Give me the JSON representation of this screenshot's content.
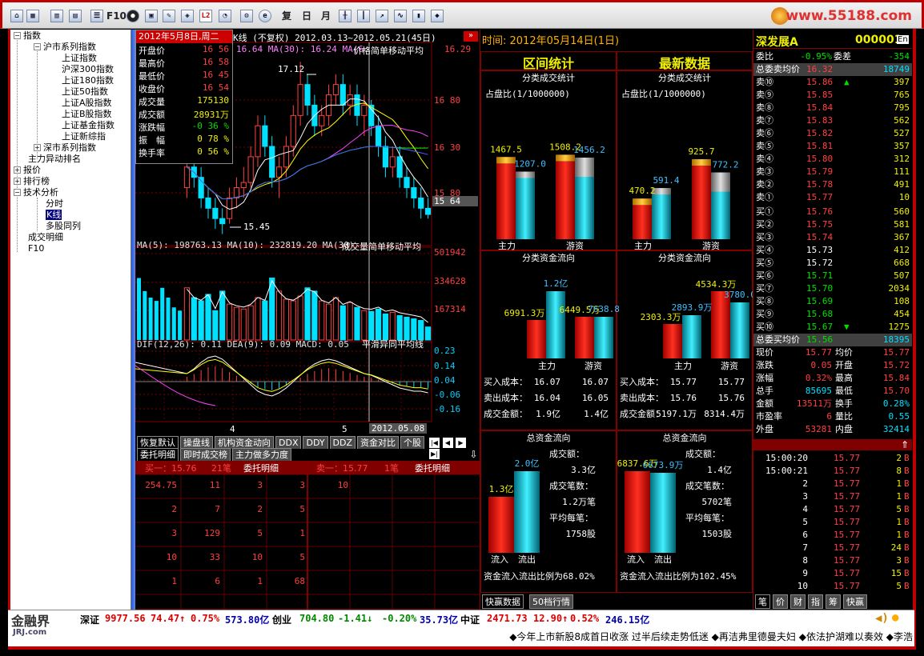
{
  "toolbar": {
    "items": [
      "复",
      "日",
      "月",
      "F10",
      "L2"
    ],
    "brand": "www.55188.com"
  },
  "tree": {
    "items": [
      "指数",
      "沪市系列指数",
      "上证指数",
      "沪深300指数",
      "上证180指数",
      "上证50指数",
      "上证A股指数",
      "上证B股指数",
      "上证基金指数",
      "上证新综指",
      "深市系列指数",
      "主力异动排名",
      "报价",
      "排行榜",
      "技术分析",
      "分时",
      "K线",
      "多股同列",
      "成交明细",
      "F10"
    ]
  },
  "chart": {
    "title_date": "2012年5月8日,周二",
    "title": "K线 (不复权) 2012.03.13~2012.05.21(45日)",
    "ma_line": "16.64  MA(30): 16.24  MA(6",
    "price_avg_label": "价格简单移动平均",
    "price_right": "16.29",
    "ohlc_labels": [
      "开盘价",
      "最高价",
      "最低价",
      "收盘价",
      "成交量",
      "成交额",
      "涨跌幅",
      "振　幅",
      "换手率"
    ],
    "ohlc_values": [
      "16 56",
      "16 58",
      "16 45",
      "16 54",
      "175130",
      "28931万",
      "-0 36 %",
      "0 78 %",
      "0 56 %"
    ],
    "price_axis": [
      "16 80",
      "16 30",
      "15 80"
    ],
    "current_price": "15 64",
    "high_label": "17.12",
    "low_label": "15.45",
    "vol_line": "MA(5): 198763.13 MA(10): 232819.20 MA(30)",
    "vol_label": "成交量简单移动平均",
    "vol_axis": [
      "501942",
      "334628",
      "167314"
    ],
    "macd_line": "DIF(12,26): 0.11 DEA(9): 0.09 MACD: 0.05",
    "macd_label": "平滑异同平均线",
    "macd_axis": [
      "0.23",
      "0.14",
      "0.04",
      "-0.06",
      "-0.16"
    ],
    "xaxis": [
      "4",
      "5",
      "2012.05.08"
    ]
  },
  "chart_data": {
    "type": "candlestick",
    "title": "K线 (不复权) 2012.03.13~2012.05.21(45日)",
    "ylim": [
      15.4,
      17.2
    ],
    "candles": [
      [
        15.9,
        16.2,
        15.8,
        16.1
      ],
      [
        16.1,
        16.3,
        15.9,
        16.0
      ],
      [
        16.0,
        16.1,
        15.7,
        15.8
      ],
      [
        15.8,
        15.9,
        15.6,
        15.7
      ],
      [
        15.7,
        15.8,
        15.5,
        15.6
      ],
      [
        15.6,
        15.7,
        15.45,
        15.55
      ],
      [
        15.6,
        15.9,
        15.55,
        15.8
      ],
      [
        15.8,
        16.0,
        15.7,
        15.9
      ],
      [
        15.9,
        16.1,
        15.8,
        15.95
      ],
      [
        15.95,
        16.3,
        15.9,
        16.2
      ],
      [
        16.2,
        16.6,
        16.1,
        16.5
      ],
      [
        16.5,
        16.6,
        16.2,
        16.3
      ],
      [
        16.3,
        16.4,
        15.9,
        16.0
      ],
      [
        16.0,
        16.2,
        15.8,
        16.1
      ],
      [
        16.1,
        16.4,
        16.0,
        16.3
      ],
      [
        16.3,
        16.7,
        16.2,
        16.6
      ],
      [
        16.6,
        17.12,
        16.5,
        16.9
      ],
      [
        16.9,
        17.0,
        16.6,
        16.7
      ],
      [
        16.7,
        16.8,
        16.4,
        16.5
      ],
      [
        16.5,
        16.7,
        16.4,
        16.6
      ],
      [
        16.6,
        16.9,
        16.5,
        16.8
      ],
      [
        16.8,
        17.0,
        16.7,
        16.9
      ],
      [
        16.9,
        17.0,
        16.6,
        16.7
      ],
      [
        16.7,
        16.9,
        16.6,
        16.8
      ],
      [
        16.8,
        16.9,
        16.5,
        16.6
      ],
      [
        16.6,
        16.8,
        16.4,
        16.7
      ],
      [
        16.7,
        16.75,
        16.4,
        16.5
      ],
      [
        16.5,
        16.6,
        16.2,
        16.3
      ],
      [
        16.3,
        16.4,
        16.0,
        16.1
      ],
      [
        16.1,
        16.3,
        16.0,
        16.2
      ],
      [
        16.2,
        16.3,
        15.9,
        16.0
      ],
      [
        16.0,
        16.1,
        15.8,
        15.9
      ],
      [
        15.9,
        16.0,
        15.7,
        15.8
      ],
      [
        15.8,
        15.9,
        15.6,
        15.7
      ],
      [
        15.7,
        15.8,
        15.6,
        15.64
      ]
    ],
    "volumes": [
      320000,
      260000,
      240000,
      280000,
      180000,
      300000,
      220000,
      200000,
      190000,
      210000,
      260000,
      240000,
      380000,
      300000,
      250000,
      240000,
      270000,
      320000,
      300000,
      240000,
      220000,
      260000,
      210000,
      230000,
      200000,
      180000,
      175130,
      190000,
      160000,
      170000,
      150000,
      140000,
      130000,
      120000,
      80000
    ],
    "macd": [
      0.05,
      0.08,
      0.12,
      0.15,
      0.16,
      0.14,
      0.1,
      0.06,
      0.02,
      -0.02,
      -0.06,
      -0.08,
      -0.09,
      -0.07,
      -0.04,
      0.0,
      0.04,
      0.08,
      0.11,
      0.13,
      0.14,
      0.13,
      0.11,
      0.09,
      0.07,
      0.05,
      0.04,
      0.02,
      0.0,
      -0.02,
      -0.04,
      -0.05,
      -0.06,
      -0.06,
      -0.07
    ]
  },
  "bottom": {
    "tabs": [
      "恢复默认",
      "操盘线",
      "机构资金动向",
      "DDX",
      "DDY",
      "DDZ",
      "资金对比",
      "个股"
    ],
    "subtabs": [
      "委托明细",
      "即时成交榜",
      "主力做多力度"
    ],
    "buy_title": "买一：15.76",
    "buy_count": "21笔",
    "buy_detail": "委托明细",
    "sell_title": "卖一：15.77",
    "sell_count": "1笔",
    "sell_detail": "委托明细",
    "rows": [
      [
        "254.75",
        "11",
        "3",
        "3",
        "10"
      ],
      [
        "2",
        "7",
        "2",
        "5",
        ""
      ],
      [
        "3",
        "129",
        "5",
        "1",
        ""
      ],
      [
        "10",
        "33",
        "10",
        "5",
        ""
      ],
      [
        "1",
        "6",
        "1",
        "68",
        ""
      ]
    ]
  },
  "mid": {
    "time": "时间: 2012年05月14日(1日)",
    "h1": "区间统计",
    "h2": "最新数据",
    "b1": {
      "t": "分类成交统计",
      "sub": "占盘比(1/1000000)",
      "v": [
        "1467.5",
        "1207.0",
        "1508.2",
        "1456.2"
      ],
      "l": [
        "主力",
        "游资"
      ]
    },
    "b2": {
      "t": "分类成交统计",
      "sub": "占盘比(1/1000000)",
      "v": [
        "470.2",
        "591.4",
        "925.7",
        "772.2"
      ],
      "l": [
        "主力",
        "游资"
      ]
    },
    "b3": {
      "t": "分类资金流向",
      "v": [
        "6991.3万",
        "1.2亿",
        "6449.5万",
        "7638.8"
      ],
      "l": [
        "主力",
        "游资"
      ],
      "rows": [
        [
          "买入成本：",
          "16.07",
          "16.07"
        ],
        [
          "卖出成本：",
          "16.04",
          "16.05"
        ],
        [
          "成交金额：",
          "1.9亿",
          "1.4亿"
        ]
      ]
    },
    "b4": {
      "t": "分类资金流向",
      "v": [
        "2303.3万",
        "2893.9万",
        "4534.3万",
        "3780.0"
      ],
      "l": [
        "主力",
        "游资"
      ],
      "rows": [
        [
          "买入成本：",
          "15.77",
          "15.77"
        ],
        [
          "卖出成本：",
          "15.76",
          "15.76"
        ],
        [
          "成交金额：",
          "5197.1万",
          "8314.4万"
        ]
      ]
    },
    "b5": {
      "t": "总资金流向",
      "v": [
        "1.3亿",
        "2.0亿"
      ],
      "l": [
        "流入",
        "流出"
      ],
      "info": [
        "成交额：",
        "3.3亿",
        "成交笔数：",
        "1.2万笔",
        "平均每笔：",
        "1758股"
      ],
      "ratio": "资金流入流出比例为68.02%"
    },
    "b6": {
      "t": "总资金流向",
      "v": [
        "6837.6万",
        "6673.9万"
      ],
      "l": [
        "流入",
        "流出"
      ],
      "info": [
        "成交额：",
        "1.4亿",
        "成交笔数：",
        "5702笔",
        "平均每笔：",
        "1503股"
      ],
      "ratio": "资金流入流出比例为102.45%"
    },
    "tabs": [
      "快赢数据",
      "50档行情"
    ]
  },
  "quote": {
    "name": "深发展A",
    "code": "000001",
    "en": "En",
    "weibi": "委比",
    "weibi_v": "-0.95%",
    "weicha": "委差",
    "weicha_v": "-354",
    "sell_avg": "总委卖均价",
    "sell_avg_p": "16.32",
    "sell_avg_v": "18749",
    "sells": [
      [
        "卖⑩",
        "15.86",
        "397"
      ],
      [
        "卖⑨",
        "15.85",
        "765"
      ],
      [
        "卖⑧",
        "15.84",
        "795"
      ],
      [
        "卖⑦",
        "15.83",
        "562"
      ],
      [
        "卖⑥",
        "15.82",
        "527"
      ],
      [
        "卖⑤",
        "15.81",
        "357"
      ],
      [
        "卖④",
        "15.80",
        "312"
      ],
      [
        "卖③",
        "15.79",
        "111"
      ],
      [
        "卖②",
        "15.78",
        "491"
      ],
      [
        "卖①",
        "15.77",
        "10"
      ]
    ],
    "buys": [
      [
        "买①",
        "15.76",
        "560"
      ],
      [
        "买②",
        "15.75",
        "581"
      ],
      [
        "买③",
        "15.74",
        "367"
      ],
      [
        "买④",
        "15.73",
        "412"
      ],
      [
        "买⑤",
        "15.72",
        "668"
      ],
      [
        "买⑥",
        "15.71",
        "507"
      ],
      [
        "买⑦",
        "15.70",
        "2034"
      ],
      [
        "买⑧",
        "15.69",
        "108"
      ],
      [
        "买⑨",
        "15.68",
        "454"
      ],
      [
        "买⑩",
        "15.67",
        "1275"
      ]
    ],
    "buy_avg": "总委买均价",
    "buy_avg_p": "15.56",
    "buy_avg_v": "18395",
    "stats": [
      [
        "现价",
        "15.77",
        "均价",
        "15.77"
      ],
      [
        "涨跌",
        "0.05",
        "开盘",
        "15.72"
      ],
      [
        "涨幅",
        "0.32%",
        "最高",
        "15.84"
      ],
      [
        "总手",
        "85695",
        "最低",
        "15.70"
      ],
      [
        "金额",
        "13511万",
        "换手",
        "0.28%"
      ],
      [
        "市盈率",
        "6",
        "量比",
        "0.55"
      ],
      [
        "外盘",
        "53281",
        "内盘",
        "32414"
      ]
    ],
    "ticks": [
      [
        "15:00:20",
        "15.77",
        "2",
        "B"
      ],
      [
        "15:00:21",
        "15.77",
        "8",
        "B"
      ],
      [
        "2",
        "15.77",
        "1",
        "B"
      ],
      [
        "3",
        "15.77",
        "1",
        "B"
      ],
      [
        "4",
        "15.77",
        "5",
        "B"
      ],
      [
        "5",
        "15.77",
        "1",
        "B"
      ],
      [
        "6",
        "15.77",
        "1",
        "B"
      ],
      [
        "7",
        "15.77",
        "24",
        "B"
      ],
      [
        "8",
        "15.77",
        "3",
        "B"
      ],
      [
        "9",
        "15.77",
        "15",
        "B"
      ],
      [
        "10",
        "15.77",
        "5",
        "B"
      ]
    ],
    "tabs": [
      "笔",
      "价",
      "财",
      "指",
      "筹",
      "快赢"
    ]
  },
  "status": {
    "logo": "金融界",
    "logo2": "JRJ.com",
    "sz": "深证",
    "sz1": "9977.56",
    "sz2": "74.47↑",
    "sz3": "0.75%",
    "sz4": "573.80亿",
    "cy": "创业",
    "cy1": "704.80",
    "cy2": "-1.41↓",
    "cy3": "-0.20%",
    "cy4": "35.73亿",
    "zz": "中证",
    "zz1": "2471.73",
    "zz2": "12.90↑",
    "zz3": "0.52%",
    "zz4": "246.15亿",
    "news": "◆今年上市新股8成首日收涨  过半后续走势低迷  ◆再洁弗里德曼夫妇  ◆依法护湖难以奏效  ◆李浩"
  }
}
